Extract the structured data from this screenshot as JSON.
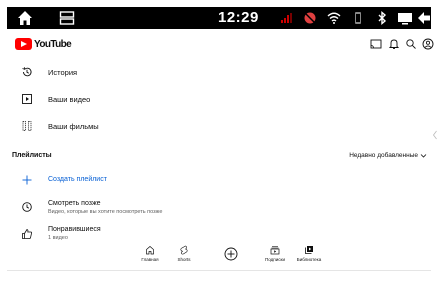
{
  "statusbar": {
    "time": "12:29",
    "icons": [
      "home-icon",
      "split-screen-icon",
      "signal-icon",
      "no-camera-icon",
      "wifi-icon",
      "phone-icon",
      "bluetooth-icon",
      "screen-icon",
      "back-icon"
    ]
  },
  "header": {
    "logo_text": "YouTube",
    "icons": [
      "cast-icon",
      "bell-icon",
      "search-icon",
      "account-icon"
    ],
    "brand_color": "#ff0000"
  },
  "library": {
    "items": [
      {
        "label": "История",
        "icon": "history-icon"
      },
      {
        "label": "Ваши видео",
        "icon": "your-videos-icon"
      },
      {
        "label": "Ваши фильмы",
        "icon": "film-icon"
      }
    ]
  },
  "playlists": {
    "title": "Плейлисты",
    "sort_label": "Недавно добавленные",
    "create_label": "Создать плейлист",
    "items": [
      {
        "title": "Смотреть позже",
        "subtitle": "Видео, которые вы хотите посмотреть позже",
        "icon": "clock-icon"
      },
      {
        "title": "Понравившиеся",
        "subtitle": "1 видео",
        "icon": "thumbs-up-icon"
      }
    ],
    "accent_color": "#065fd4"
  },
  "bottom_nav": {
    "items": [
      {
        "label": "Главная",
        "icon": "home-icon"
      },
      {
        "label": "Shorts",
        "icon": "shorts-icon"
      },
      {
        "label": "Подписки",
        "icon": "subscriptions-icon"
      },
      {
        "label": "Библиотека",
        "icon": "library-icon"
      }
    ],
    "add_icon": "add-circle-icon"
  }
}
